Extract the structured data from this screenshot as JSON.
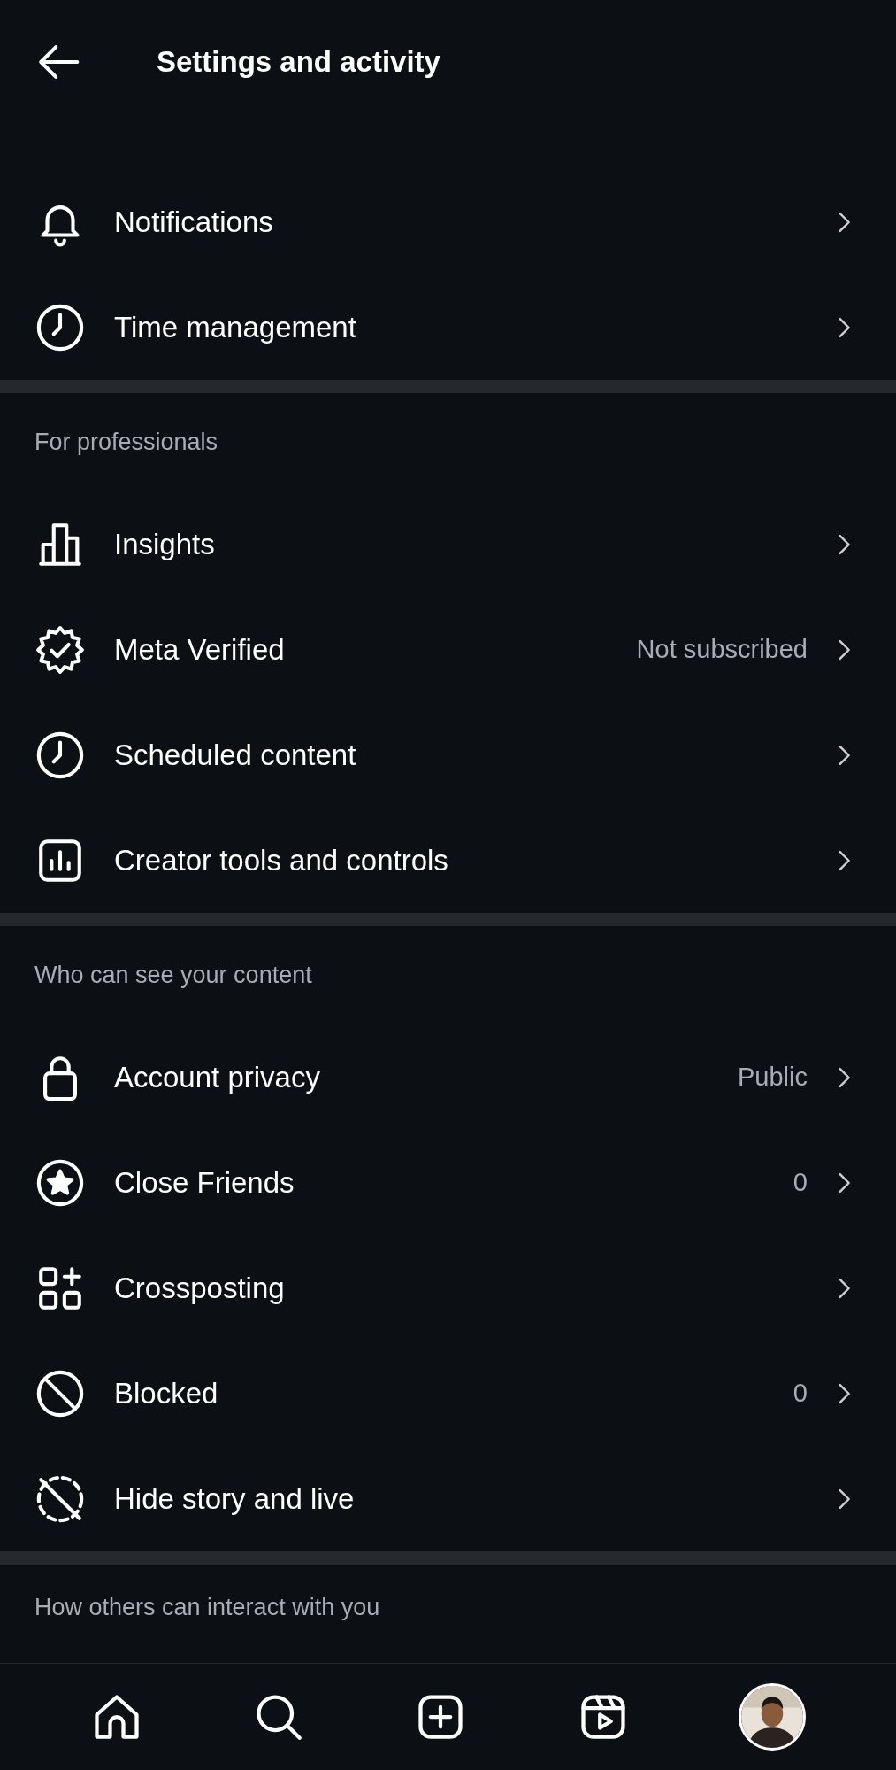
{
  "header": {
    "title": "Settings and activity"
  },
  "sections": [
    {
      "items": [
        {
          "label": "Notifications"
        },
        {
          "label": "Time management"
        }
      ]
    },
    {
      "heading": "For professionals",
      "items": [
        {
          "label": "Insights"
        },
        {
          "label": "Meta Verified",
          "value": "Not subscribed"
        },
        {
          "label": "Scheduled content"
        },
        {
          "label": "Creator tools and controls"
        }
      ]
    },
    {
      "heading": "Who can see your content",
      "items": [
        {
          "label": "Account privacy",
          "value": "Public"
        },
        {
          "label": "Close Friends",
          "value": "0"
        },
        {
          "label": "Crossposting"
        },
        {
          "label": "Blocked",
          "value": "0"
        },
        {
          "label": "Hide story and live"
        }
      ]
    },
    {
      "heading": "How others can interact with you"
    }
  ]
}
